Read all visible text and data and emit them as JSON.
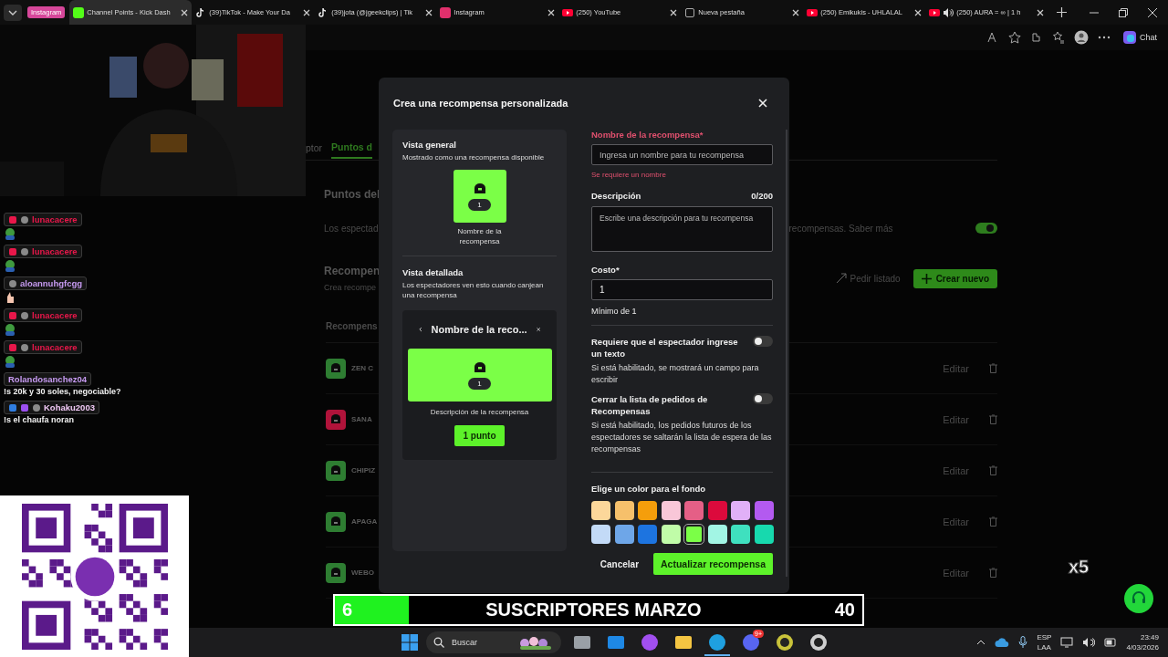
{
  "browser": {
    "group_label": "Instagram",
    "tabs": [
      {
        "title": "Channel Points - Kick Dash",
        "kind": "kick",
        "selected": true,
        "playing": false
      },
      {
        "title": "(39)TikTok - Make Your Da",
        "kind": "tiktok",
        "selected": false,
        "playing": false
      },
      {
        "title": "(39)jota (@jgeekclips) | Tik",
        "kind": "tiktok",
        "selected": false,
        "playing": false
      },
      {
        "title": "Instagram",
        "kind": "instagram",
        "selected": false,
        "playing": false
      },
      {
        "title": "(250) YouTube",
        "kind": "youtube",
        "selected": false,
        "playing": false
      },
      {
        "title": "Nueva pestaña",
        "kind": "page",
        "selected": false,
        "playing": false
      },
      {
        "title": "(250) Emikukis - UHLALAL",
        "kind": "youtube",
        "selected": false,
        "playing": false
      },
      {
        "title": "(250) AURA = ∞ | 1 h",
        "kind": "youtube",
        "selected": false,
        "playing": true
      }
    ],
    "chat_button": "Chat"
  },
  "page": {
    "tabs": [
      {
        "label": "ptor",
        "selected": false
      },
      {
        "label": "Puntos d",
        "selected": true
      }
    ],
    "section_title": "Puntos del",
    "section_text_start": "Los espectad",
    "section_text_end": "recompensas. Saber más",
    "points_enabled": {
      "on": true
    },
    "rewards_title": "Recompen",
    "rewards_subtitle": "Crea recompe",
    "request_button": "Pedir listado",
    "create_button": "Crear nuevo",
    "list_header": "Recompens",
    "rewards": [
      {
        "name": "ZEN C",
        "color": "#2e7d32",
        "action": "Editar"
      },
      {
        "name": "SANA",
        "color": "#b0133a",
        "action": "Editar"
      },
      {
        "name": "CHIPIZ",
        "color": "#2e7d32",
        "action": "Editar"
      },
      {
        "name": "APAGA",
        "color": "#2e7d32",
        "action": "Editar"
      },
      {
        "name": "WEBO",
        "color": "#2e7d32",
        "action": "Editar"
      }
    ]
  },
  "modal": {
    "title": "Crea una recompensa personalizada",
    "overview_title": "Vista general",
    "overview_text": "Mostrado como una recompensa disponible",
    "tile_cost": "1",
    "tile_name": "Nombre de la recompensa",
    "detail_title": "Vista detallada",
    "detail_text": "Los espectadores ven esto cuando canjean una recompensa",
    "detail_header": "Nombre de la reco...",
    "detail_cost": "1",
    "detail_description": "Descripción de la recompensa",
    "detail_button": "1 punto",
    "name_label": "Nombre de la recompensa*",
    "name_placeholder": "Ingresa un nombre para tu recompensa",
    "name_error": "Se requiere un nombre",
    "description_label": "Descripción",
    "description_count": "0/200",
    "description_placeholder": "Escribe una descripción para tu recompensa",
    "cost_label": "Costo*",
    "cost_value": "1",
    "cost_hint": "Mínimo de 1",
    "toggles": [
      {
        "label": "Requiere que el espectador ingrese un texto",
        "help": "Si está habilitado, se mostrará un campo para escribir",
        "on": false
      },
      {
        "label": "Cerrar la lista de pedidos de Recompensas",
        "help": "Si está habilitado, los pedidos futuros de los espectadores se saltarán la lista de espera de las recompensas",
        "on": false
      }
    ],
    "color_label": "Elige un color para el fondo",
    "swatches": [
      {
        "color": "#fcd79a",
        "selected": false
      },
      {
        "color": "#f6c06b",
        "selected": false
      },
      {
        "color": "#f59e0b",
        "selected": false
      },
      {
        "color": "#f9c7d8",
        "selected": false
      },
      {
        "color": "#e55f86",
        "selected": false
      },
      {
        "color": "#dc0a3c",
        "selected": false
      },
      {
        "color": "#e1b0f7",
        "selected": false
      },
      {
        "color": "#b35af0",
        "selected": false
      },
      {
        "color": "#c3daf7",
        "selected": false
      },
      {
        "color": "#6ea6e8",
        "selected": false
      },
      {
        "color": "#1d74e0",
        "selected": false
      },
      {
        "color": "#c0fca8",
        "selected": false
      },
      {
        "color": "#7bff47",
        "selected": true
      },
      {
        "color": "#a2f5e4",
        "selected": false
      },
      {
        "color": "#3fe0bf",
        "selected": false
      },
      {
        "color": "#17d9ae",
        "selected": false
      }
    ],
    "cancel_button": "Cancelar",
    "submit_button": "Actualizar recompensa"
  },
  "chat": [
    {
      "user": "lunacacere",
      "color": "#e8174a",
      "badges": [
        {
          "kind": "sub"
        },
        {
          "kind": "mod"
        }
      ],
      "emote": {
        "kind": "frog"
      }
    },
    {
      "user": "lunacacere",
      "color": "#e8174a",
      "badges": [
        {
          "kind": "sub"
        },
        {
          "kind": "mod"
        }
      ],
      "emote": {
        "kind": "frog"
      }
    },
    {
      "user": "aloannuhgfcgg",
      "color": "#c79bf2",
      "badges": [
        {
          "kind": "mod"
        }
      ],
      "emote": {
        "kind": "hand"
      }
    },
    {
      "user": "lunacacere",
      "color": "#e8174a",
      "badges": [
        {
          "kind": "sub"
        },
        {
          "kind": "mod"
        }
      ],
      "emote": {
        "kind": "frog"
      }
    },
    {
      "user": "lunacacere",
      "color": "#e8174a",
      "badges": [
        {
          "kind": "sub"
        },
        {
          "kind": "mod"
        }
      ],
      "emote": {
        "kind": "frog"
      }
    },
    {
      "user": "Rolandosanchez04",
      "color": "#c79bf2",
      "text": "!s 20k y 30 soles, negociable?"
    },
    {
      "user": "Kohaku2003",
      "color": "#f0c8f5",
      "badges": [
        {
          "kind": "prime"
        },
        {
          "kind": "gem"
        },
        {
          "kind": "mod"
        }
      ],
      "text": "!s el chaufa noran"
    }
  ],
  "subs_goal": {
    "current": "6",
    "title": "SUSCRIPTORES MARZO",
    "goal": "40",
    "level": 0.14
  },
  "alert_multiplier": "x5",
  "taskbar": {
    "search_placeholder": "Buscar",
    "apps": [
      {
        "kind": "taskview",
        "active": false
      },
      {
        "kind": "store",
        "active": false
      },
      {
        "kind": "copilot",
        "active": false
      },
      {
        "kind": "folder",
        "active": false
      },
      {
        "kind": "edge",
        "active": true
      },
      {
        "kind": "discord",
        "active": false,
        "badge": "9+"
      },
      {
        "kind": "clock",
        "active": false
      },
      {
        "kind": "obs",
        "active": false
      }
    ],
    "language": "ESP",
    "layout": "LAA",
    "time": "23:49",
    "date": "4/03/2026"
  }
}
